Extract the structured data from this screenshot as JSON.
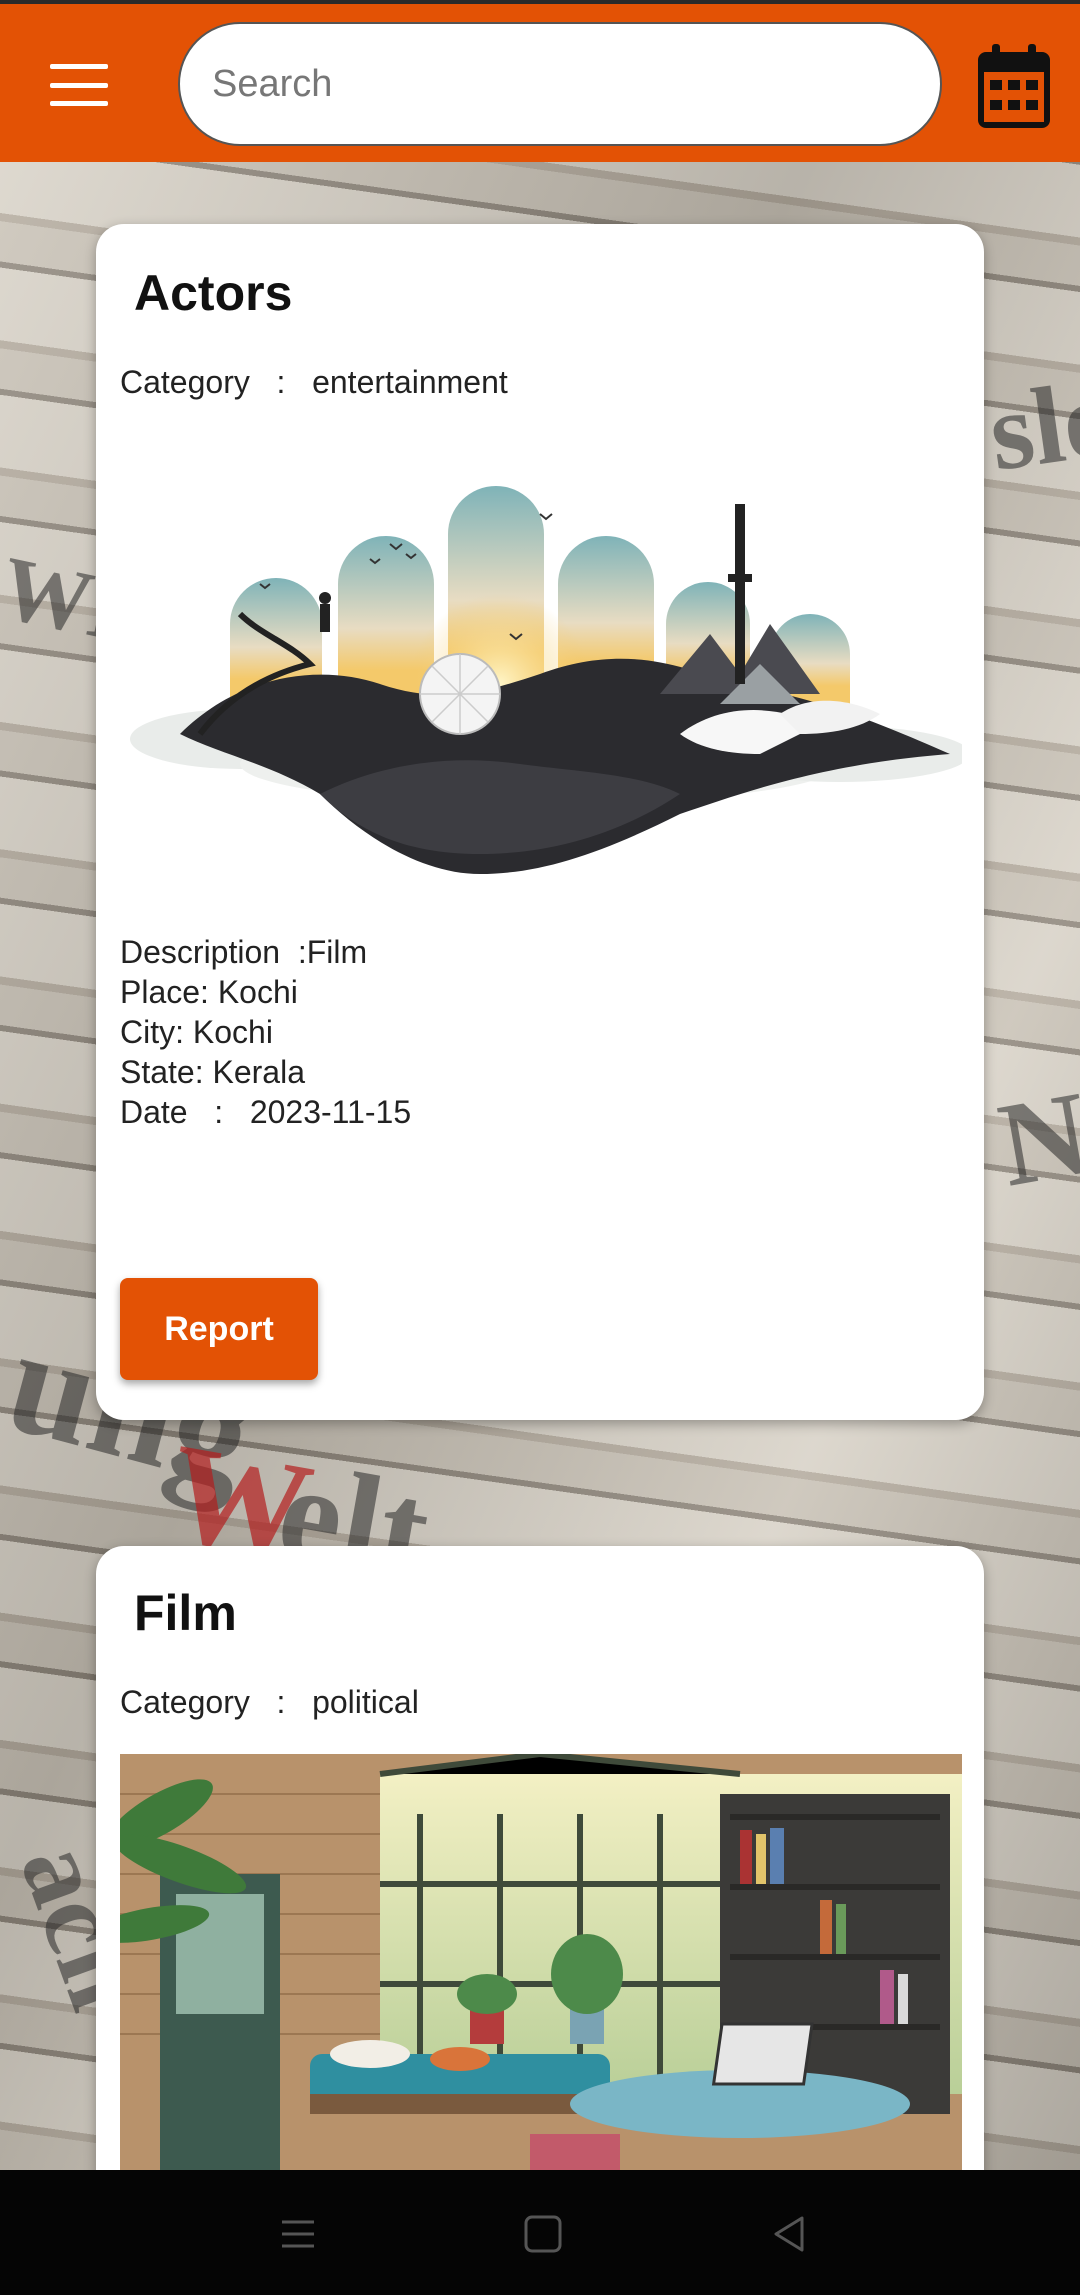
{
  "search": {
    "placeholder": "Search"
  },
  "cards": [
    {
      "title": "Actors",
      "category_label": "Category",
      "category_sep": ":",
      "category_value": "entertainment",
      "description": "Description  :Film",
      "place": "Place: Kochi",
      "city": "City: Kochi",
      "state": "State: Kerala",
      "date": "Date   :   2023-11-15",
      "report_label": "Report"
    },
    {
      "title": "Film",
      "category_label": "Category",
      "category_sep": ":",
      "category_value": "political"
    }
  ],
  "colors": {
    "accent": "#e35205",
    "card": "#ffffff",
    "nav_bar": "#050505"
  },
  "icons": {
    "menu": "hamburger-menu-icon",
    "calendar": "calendar-icon",
    "nav_recents": "recents-icon",
    "nav_home": "home-icon",
    "nav_back": "back-icon"
  }
}
